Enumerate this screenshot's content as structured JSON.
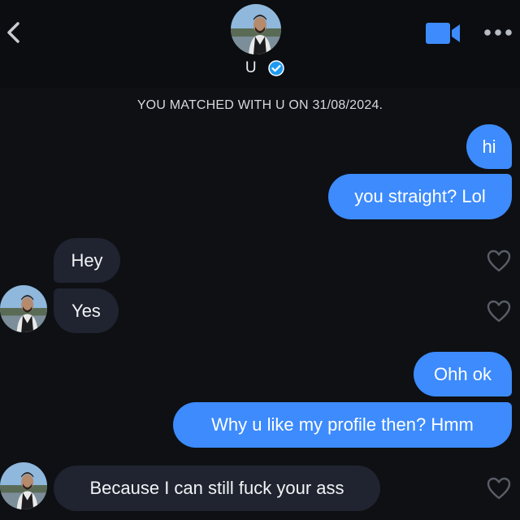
{
  "header": {
    "name": "U",
    "verified": true
  },
  "match_notice": "YOU MATCHED WITH U ON 31/08/2024.",
  "messages": [
    {
      "direction": "outgoing",
      "text": "hi"
    },
    {
      "direction": "outgoing",
      "text": "you straight? Lol"
    },
    {
      "direction": "incoming",
      "text": "Hey"
    },
    {
      "direction": "incoming",
      "text": "Yes"
    },
    {
      "direction": "outgoing",
      "text": "Ohh ok"
    },
    {
      "direction": "outgoing",
      "text": "Why u like my profile then? Hmm"
    },
    {
      "direction": "incoming",
      "text": "Because I can still fuck your ass"
    }
  ],
  "colors": {
    "background": "#0e1014",
    "header_background": "#0b0d10",
    "outgoing_bubble": "#3d8bfd",
    "incoming_bubble": "#1f2430",
    "verified_badge": "#1d9bf0",
    "video_icon": "#3d8bfd"
  },
  "icons": [
    "back-chevron-icon",
    "verified-badge-icon",
    "video-call-icon",
    "more-options-icon",
    "heart-outline-icon"
  ]
}
